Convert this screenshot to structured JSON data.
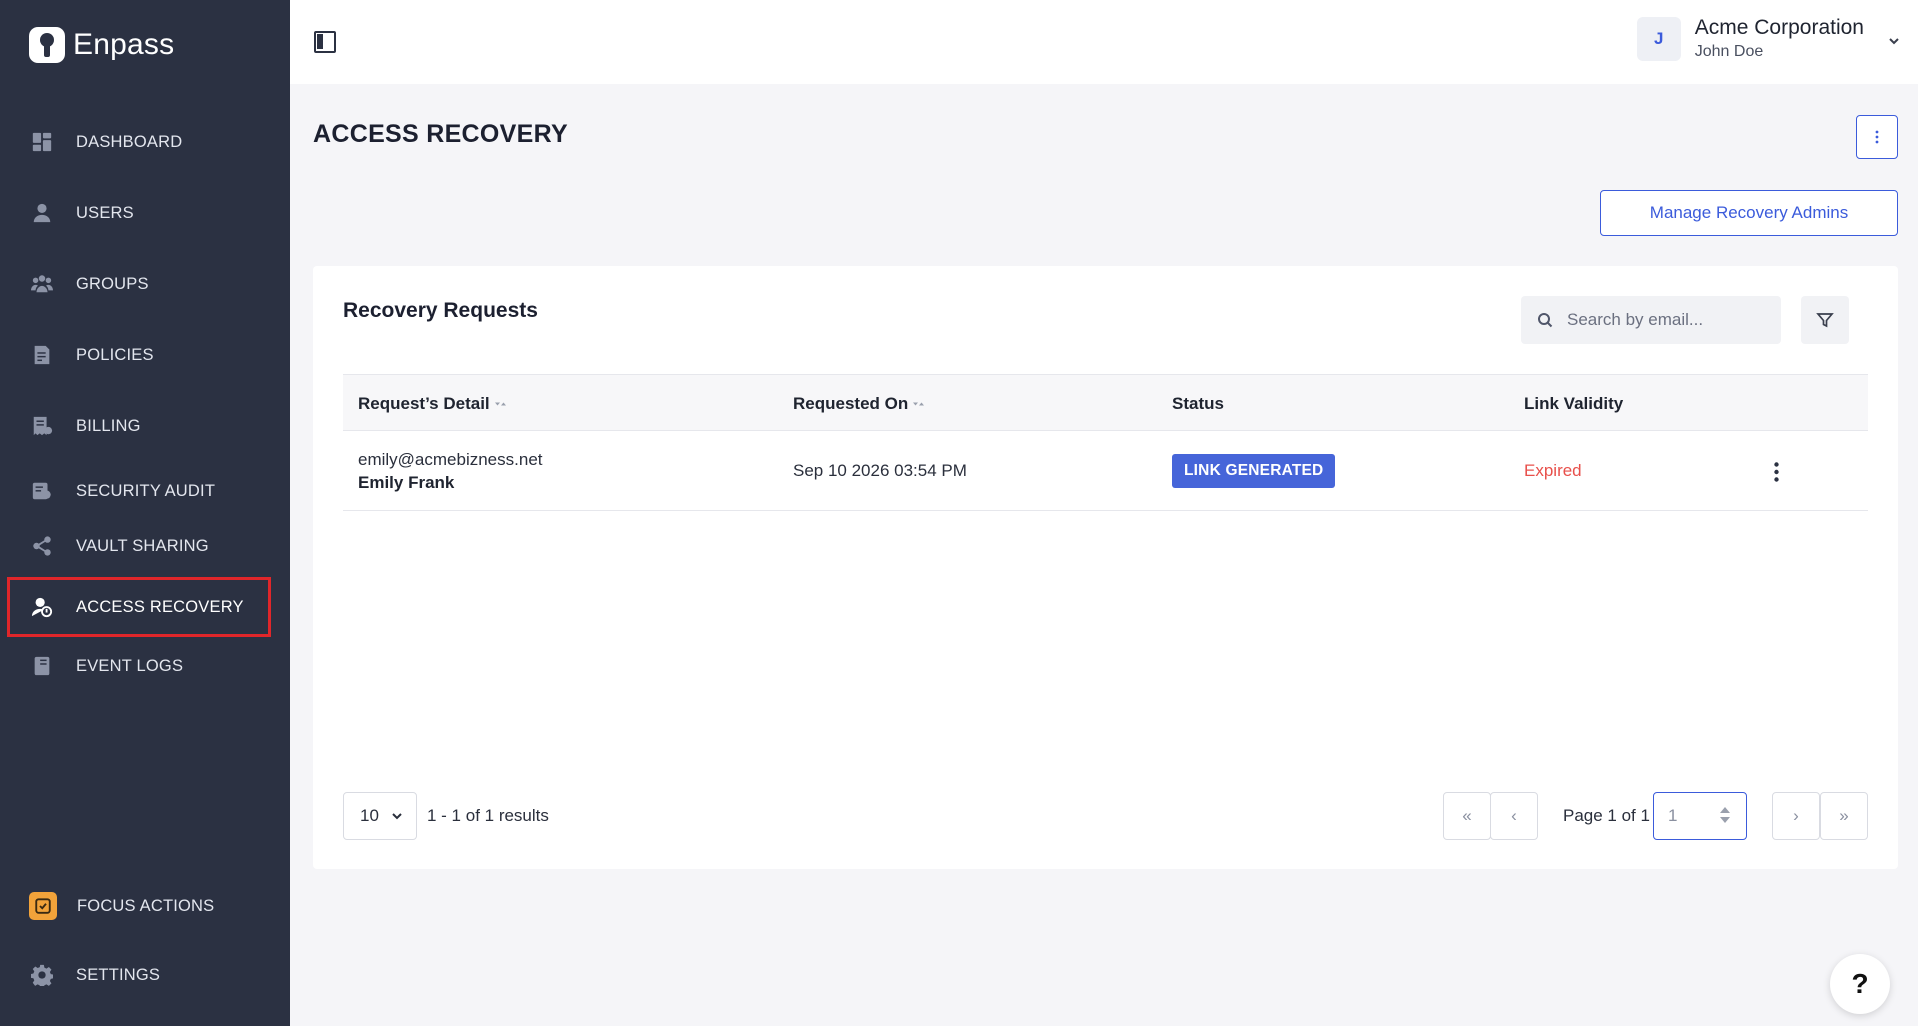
{
  "app": {
    "name": "Enpass"
  },
  "sidebar": {
    "items": [
      {
        "label": "DASHBOARD"
      },
      {
        "label": "USERS"
      },
      {
        "label": "GROUPS"
      },
      {
        "label": "POLICIES"
      },
      {
        "label": "BILLING"
      },
      {
        "label": "SECURITY AUDIT"
      },
      {
        "label": "VAULT SHARING"
      },
      {
        "label": "ACCESS RECOVERY",
        "active": true
      },
      {
        "label": "EVENT LOGS"
      }
    ],
    "bottom": [
      {
        "label": "FOCUS ACTIONS"
      },
      {
        "label": "SETTINGS"
      }
    ]
  },
  "account": {
    "initial": "J",
    "org": "Acme Corporation",
    "user": "John Doe"
  },
  "page": {
    "title": "ACCESS RECOVERY",
    "manage_button": "Manage Recovery Admins"
  },
  "card": {
    "title": "Recovery Requests",
    "search_placeholder": "Search by email...",
    "columns": [
      "Request’s Detail",
      "Requested On",
      "Status",
      "Link Validity"
    ],
    "rows": [
      {
        "email": "emily@acmebizness.net",
        "name": "Emily Frank",
        "requested_on": "Sep 10 2026 03:54 PM",
        "status": "LINK GENERATED",
        "validity": "Expired"
      }
    ]
  },
  "pagination": {
    "page_size": "10",
    "results": "1 - 1 of 1 results",
    "page_of": "Page 1 of 1",
    "page_input": "1",
    "first": "«",
    "prev": "‹",
    "next": "›",
    "last": "»"
  },
  "help": {
    "label": "?"
  },
  "colors": {
    "sidebar_bg": "#2b3142",
    "accent": "#3b5bdb",
    "active_outline": "#e0262a",
    "expired": "#e8504b",
    "badge": "#4665d9"
  }
}
